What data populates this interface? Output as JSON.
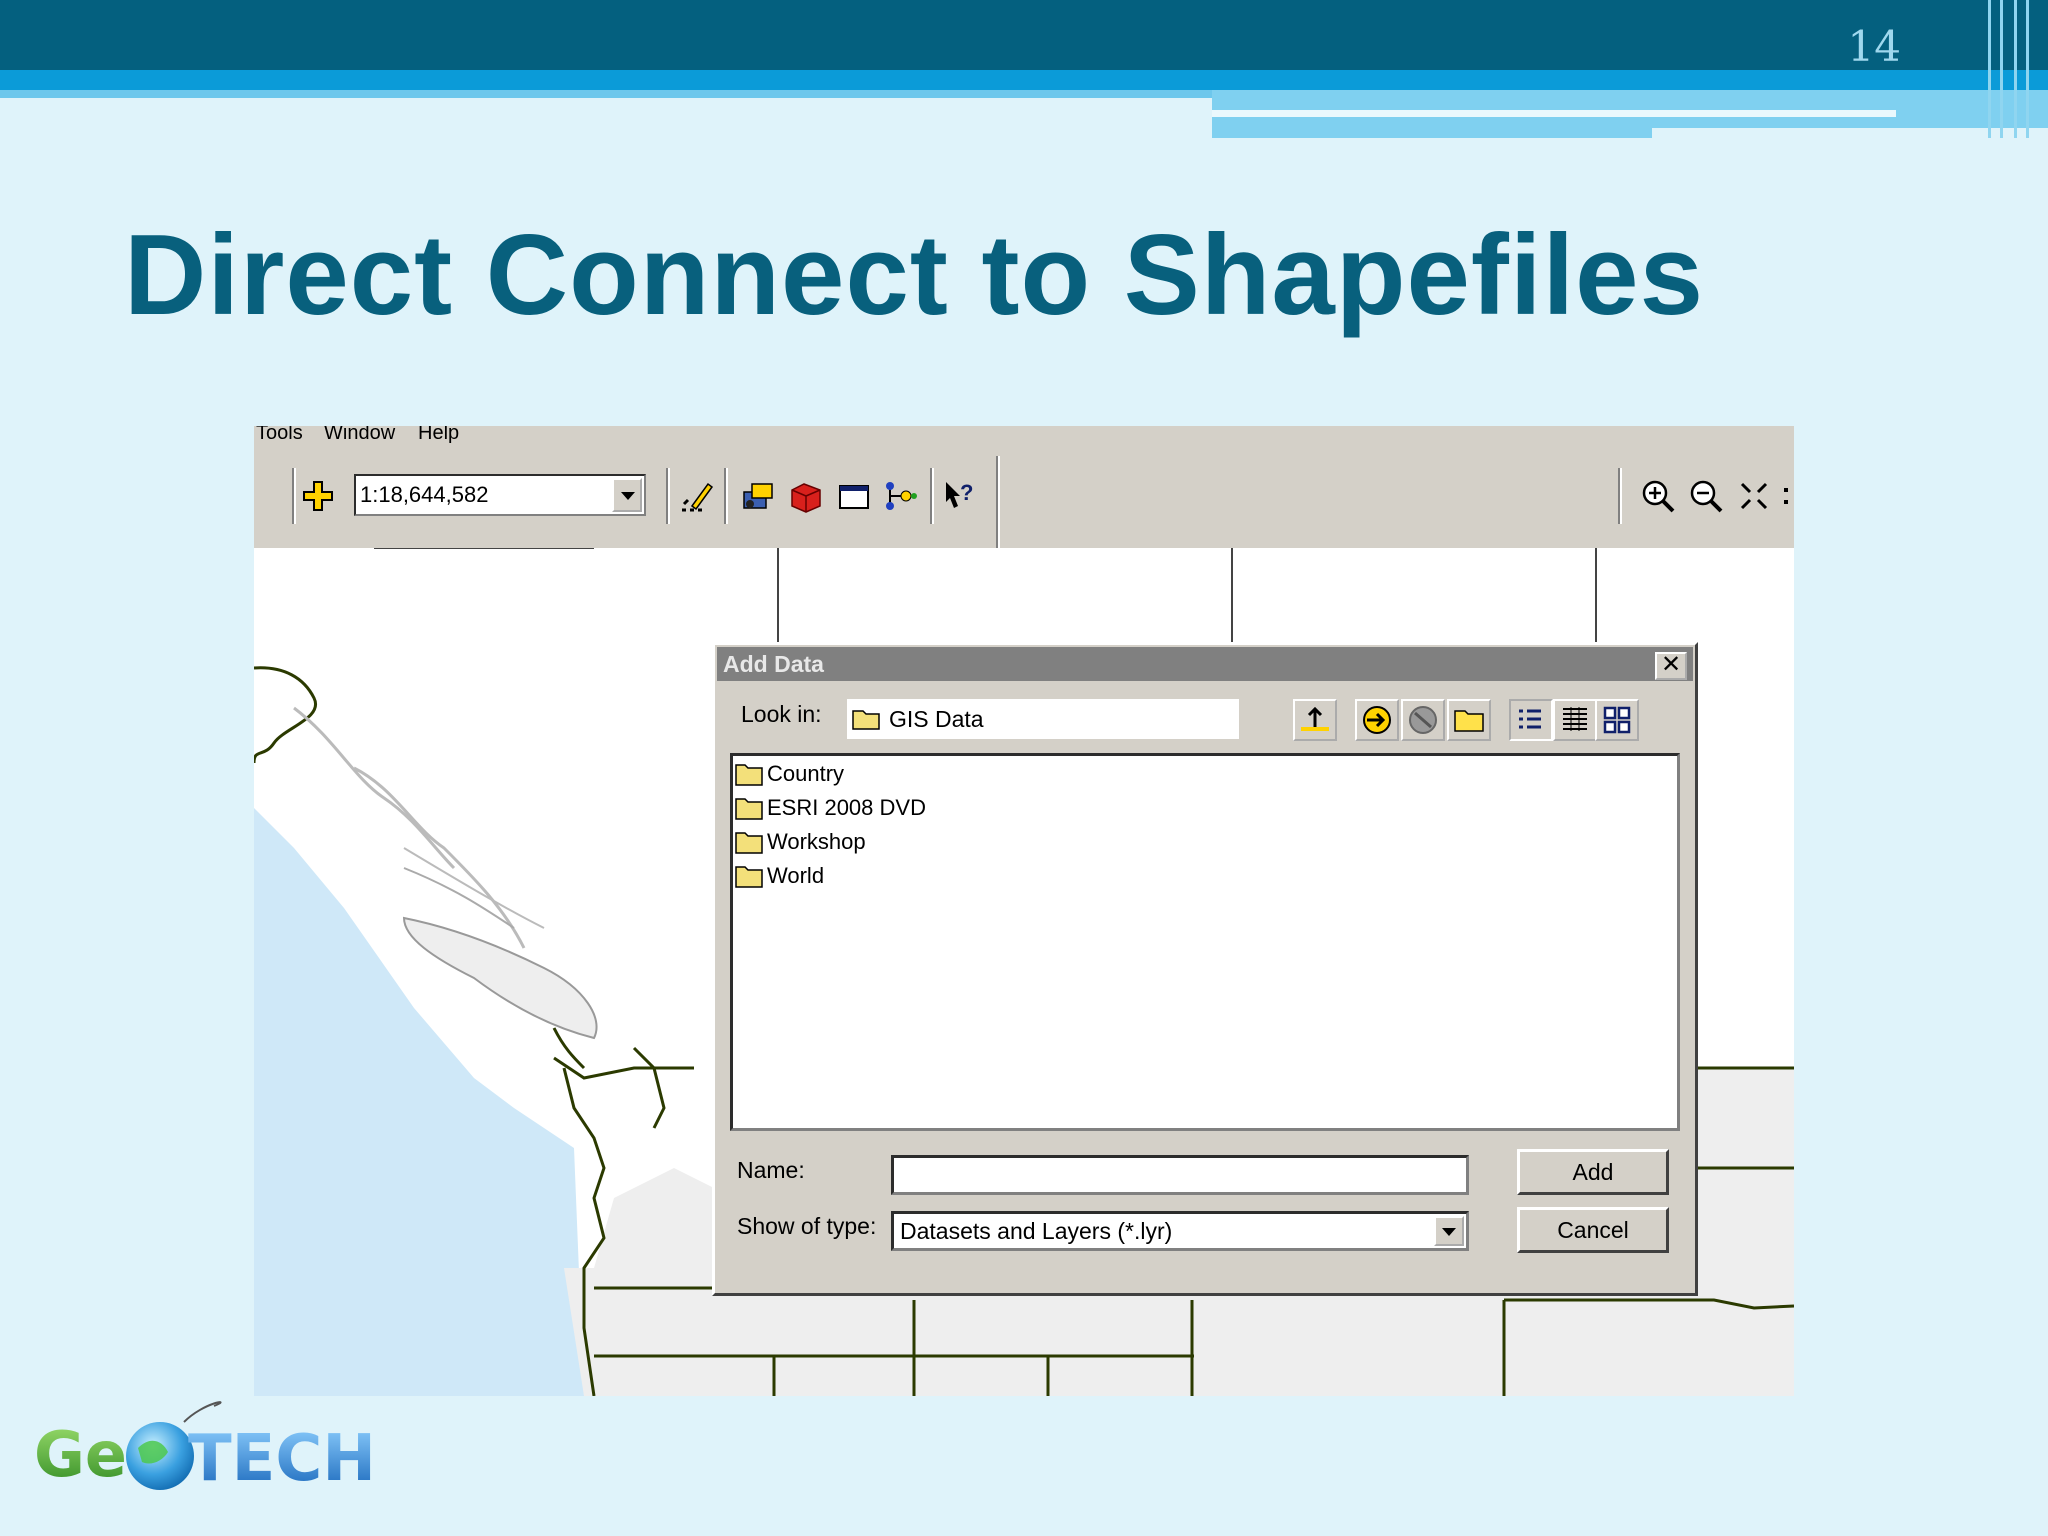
{
  "slide": {
    "number": "14",
    "title": "Direct Connect to Shapefiles"
  },
  "app": {
    "menu": [
      "Tools",
      "Window",
      "Help"
    ],
    "toolbar": {
      "scale_value": "1:18,644,582",
      "icons": [
        "add-data-icon",
        "editor-toolbar-icon",
        "arc-toolbox-icon",
        "toolbox-icon",
        "command-line-icon",
        "model-builder-icon",
        "whats-this-help-icon",
        "zoom-in-icon",
        "zoom-out-icon",
        "fixed-zoom-in-icon"
      ]
    }
  },
  "dialog": {
    "title": "Add Data",
    "close_label": "✕",
    "look_in_label": "Look in:",
    "look_in_value": "GIS Data",
    "toolbar_icons": [
      "up-one-level-icon",
      "connect-to-folder-icon",
      "disconnect-from-folder-icon",
      "new-folder-icon",
      "list-view-icon",
      "details-view-icon",
      "thumbnails-view-icon"
    ],
    "files": [
      "Country",
      "ESRI 2008 DVD",
      "Workshop",
      "World"
    ],
    "name_label": "Name:",
    "name_value": "",
    "type_label": "Show of type:",
    "type_value": "Datasets and Layers (*.lyr)",
    "add_label": "Add",
    "cancel_label": "Cancel"
  },
  "logo": {
    "text": "GeoTECH"
  },
  "colors": {
    "title": "#08607d",
    "top_bar": "#04607f",
    "slide_bg": "#dff3fa",
    "win_face": "#d4d0c8",
    "ocean": "#cfe8f8",
    "land": "#eeeeee",
    "border_line": "#2b3a00"
  }
}
